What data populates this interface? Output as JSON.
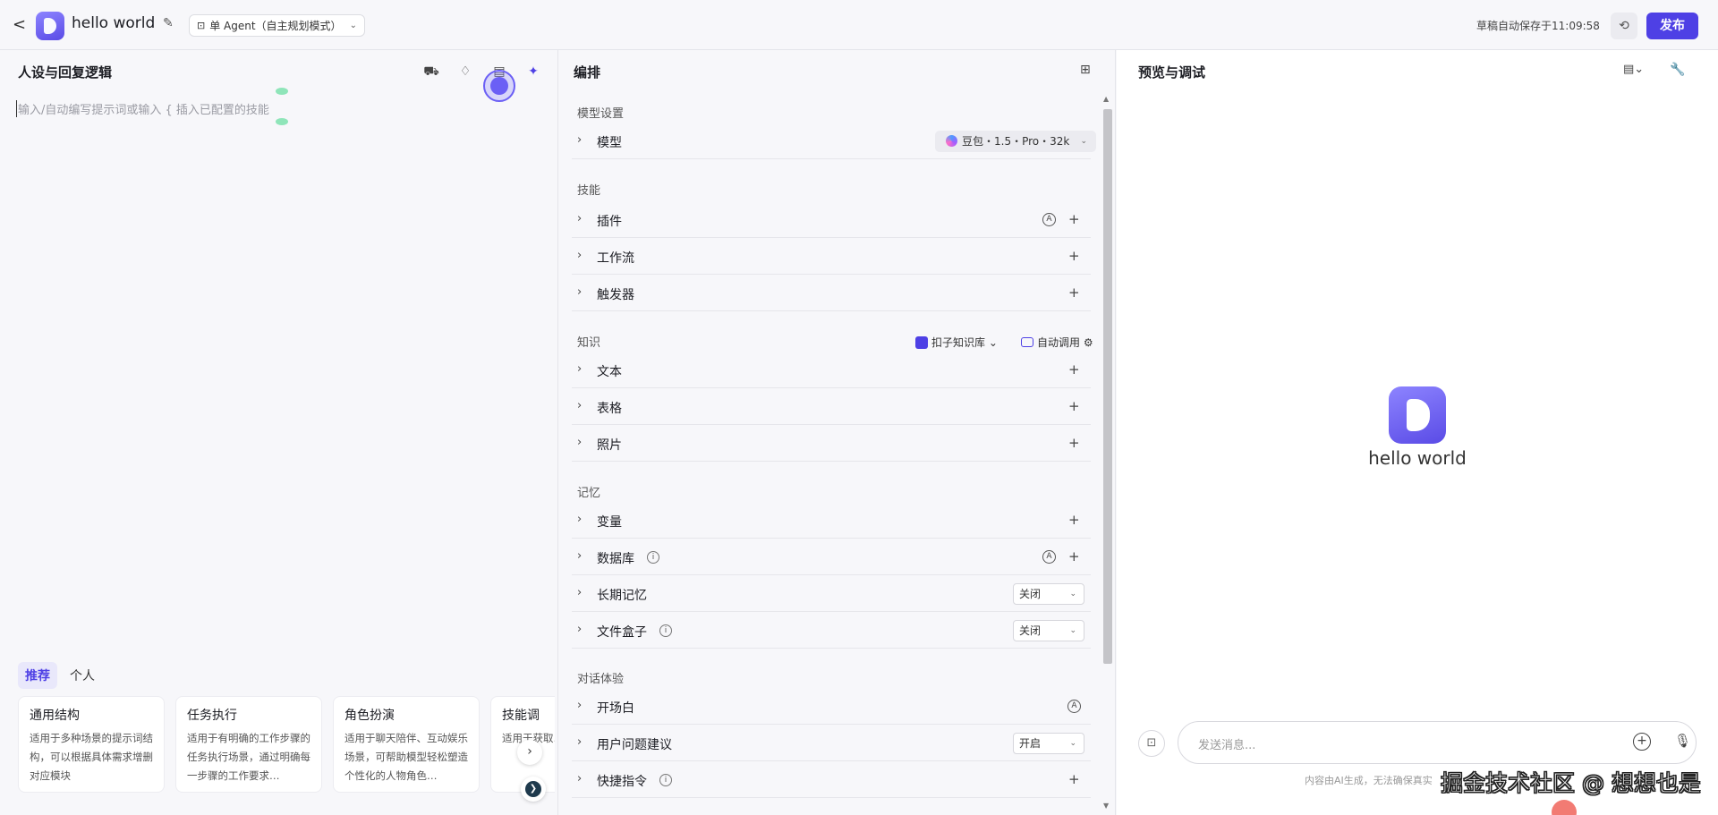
{
  "header": {
    "back": "<",
    "title": "hello world",
    "mode": "单 Agent（自主规划模式）",
    "autosave": "草稿自动保存于11:09:58",
    "publish": "发布"
  },
  "left": {
    "title": "人设与回复逻辑",
    "placeholder": "输入/自动编写提示词或输入 { 插入已配置的技能",
    "tabs": [
      "推荐",
      "个人"
    ],
    "cards": [
      {
        "title": "通用结构",
        "desc": "适用于多种场景的提示词结构，可以根据具体需求增删对应模块"
      },
      {
        "title": "任务执行",
        "desc": "适用于有明确的工作步骤的任务执行场景，通过明确每一步骤的工作要求…"
      },
      {
        "title": "角色扮演",
        "desc": "适用于聊天陪伴、互动娱乐场景，可帮助模型轻松塑造个性化的人物角色…"
      },
      {
        "title": "技能调",
        "desc": "适用于获取…的场景"
      }
    ]
  },
  "mid": {
    "title": "编排",
    "sections": {
      "model": "模型设置",
      "skills": "技能",
      "knowledge": "知识",
      "memory": "记忆",
      "dialog": "对话体验"
    },
    "model_row": {
      "label": "模型",
      "value": "豆包・1.5・Pro・32k"
    },
    "skills": [
      "插件",
      "工作流",
      "触发器"
    ],
    "knowledge_source": "扣子知识库",
    "knowledge_mode": "自动调用",
    "knowledge": [
      "文本",
      "表格",
      "照片"
    ],
    "memory": [
      "变量",
      "数据库",
      "长期记忆",
      "文件盒子"
    ],
    "memory_values": {
      "long_term": "关闭",
      "file_box": "关闭"
    },
    "dialog": [
      "开场白",
      "用户问题建议",
      "快捷指令"
    ],
    "dialog_values": {
      "suggest": "开启"
    },
    "auto_badge": "A"
  },
  "right": {
    "title": "预览与调试",
    "bot_name": "hello world",
    "input_placeholder": "发送消息...",
    "footer": "内容由AI生成，无法确保真实",
    "watermark": "掘金技术社区 @ 想想也是"
  },
  "colors": {
    "accent": "#4e40e5"
  },
  "icons": [
    "back-icon",
    "edit-icon",
    "history-icon",
    "grid-icon",
    "plus-icon",
    "mic-icon",
    "info-icon"
  ]
}
